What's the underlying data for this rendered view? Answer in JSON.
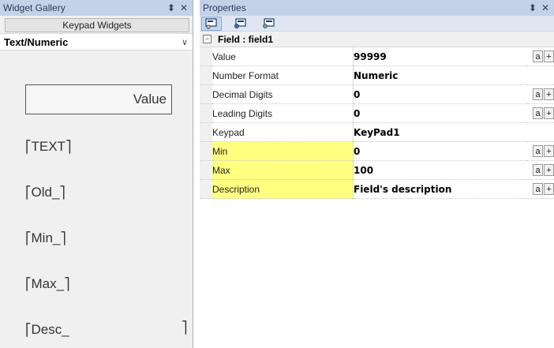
{
  "left_panel": {
    "title": "Widget Gallery",
    "tab_label": "Keypad Widgets",
    "category": "Text/Numeric",
    "widgets": {
      "value": "Value",
      "text": "TEXT",
      "old": "Old_",
      "min": "Min_",
      "max": "Max_",
      "desc": "Desc_"
    }
  },
  "right_panel": {
    "title": "Properties",
    "group_label": "Field : field1",
    "rows": [
      {
        "name": "Value",
        "value": "99999",
        "highlight": false,
        "buttons": true
      },
      {
        "name": "Number Format",
        "value": "Numeric",
        "highlight": false,
        "buttons": false
      },
      {
        "name": "Decimal Digits",
        "value": "0",
        "highlight": false,
        "buttons": true
      },
      {
        "name": "Leading Digits",
        "value": "0",
        "highlight": false,
        "buttons": true
      },
      {
        "name": "Keypad",
        "value": "KeyPad1",
        "highlight": false,
        "buttons": false
      },
      {
        "name": "Min",
        "value": "0",
        "highlight": true,
        "buttons": true
      },
      {
        "name": "Max",
        "value": "100",
        "highlight": true,
        "buttons": true
      },
      {
        "name": "Description",
        "value": "Field's description",
        "highlight": true,
        "buttons": true
      }
    ],
    "button_a_label": "a",
    "button_plus_label": "+"
  },
  "icons": {
    "pin": "pin-icon",
    "close": "close-icon",
    "collapse": "collapse-icon",
    "chevron": "chevron-down-icon"
  },
  "colors": {
    "titlebar": "#c5d1e6",
    "highlight": "#ffff80",
    "panel_bg": "#f0f0f0"
  }
}
